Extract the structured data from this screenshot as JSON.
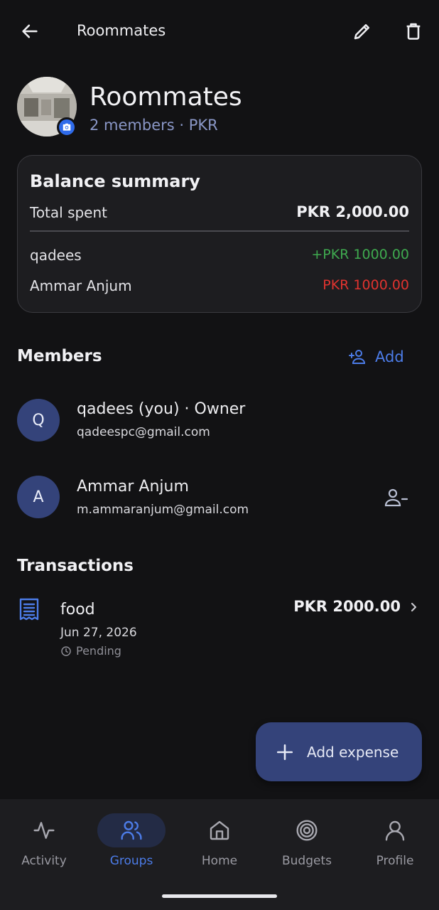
{
  "topbar": {
    "title": "Roommates"
  },
  "group": {
    "name": "Roommates",
    "meta": "2 members · PKR"
  },
  "balance": {
    "title": "Balance summary",
    "total_label": "Total spent",
    "total_value": "PKR 2,000.00",
    "rows": [
      {
        "name": "qadees",
        "amount": "+PKR 1000.00",
        "color": "#3FAA4F"
      },
      {
        "name": "Ammar Anjum",
        "amount": "PKR 1000.00",
        "color": "#E0332F"
      }
    ]
  },
  "members": {
    "title": "Members",
    "add_label": "Add",
    "items": [
      {
        "initial": "Q",
        "name": "qadees (you) · Owner",
        "email": "qadeespc@gmail.com"
      },
      {
        "initial": "A",
        "name": "Ammar Anjum",
        "email": "m.ammaranjum@gmail.com"
      }
    ]
  },
  "transactions": {
    "title": "Transactions",
    "items": [
      {
        "name": "food",
        "date": "Jun 27, 2026",
        "status": "Pending",
        "amount": "PKR 2000.00",
        "icon": "receipt-icon"
      }
    ]
  },
  "fab": {
    "label": "Add expense"
  },
  "nav": {
    "items": [
      {
        "label": "Activity",
        "icon": "activity-icon"
      },
      {
        "label": "Groups",
        "icon": "groups-icon",
        "active": true
      },
      {
        "label": "Home",
        "icon": "home-icon"
      },
      {
        "label": "Budgets",
        "icon": "target-icon"
      },
      {
        "label": "Profile",
        "icon": "profile-icon"
      }
    ]
  },
  "colors": {
    "accent": "#4C7CE8",
    "avatar": "#34437A",
    "positive": "#3FAA4F",
    "negative": "#E0332F",
    "background": "#121214",
    "card": "#1D1D20"
  }
}
